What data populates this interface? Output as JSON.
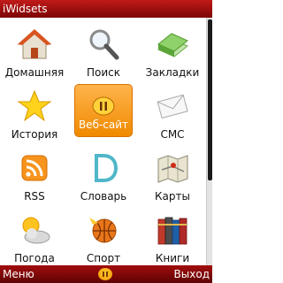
{
  "app": {
    "title": "iWidsets"
  },
  "grid": {
    "items": [
      {
        "label": "Домашняя",
        "icon": "home-icon"
      },
      {
        "label": "Поиск",
        "icon": "search-icon"
      },
      {
        "label": "Закладки",
        "icon": "bookmarks-icon"
      },
      {
        "label": "История",
        "icon": "history-icon"
      },
      {
        "label": "Веб-сайт",
        "icon": "website-icon",
        "selected": true
      },
      {
        "label": "СМС",
        "icon": "sms-icon"
      },
      {
        "label": "RSS",
        "icon": "rss-icon"
      },
      {
        "label": "Словарь",
        "icon": "dictionary-icon"
      },
      {
        "label": "Карты",
        "icon": "maps-icon"
      },
      {
        "label": "Погода",
        "icon": "weather-icon"
      },
      {
        "label": "Спорт",
        "icon": "sport-icon"
      },
      {
        "label": "Книги",
        "icon": "books-icon"
      }
    ]
  },
  "softkeys": {
    "left": "Меню",
    "right": "Выход",
    "center_icon": "pause-icon"
  },
  "colors": {
    "bar_red": "#a20d0d",
    "selection_orange": "#f5a020"
  }
}
